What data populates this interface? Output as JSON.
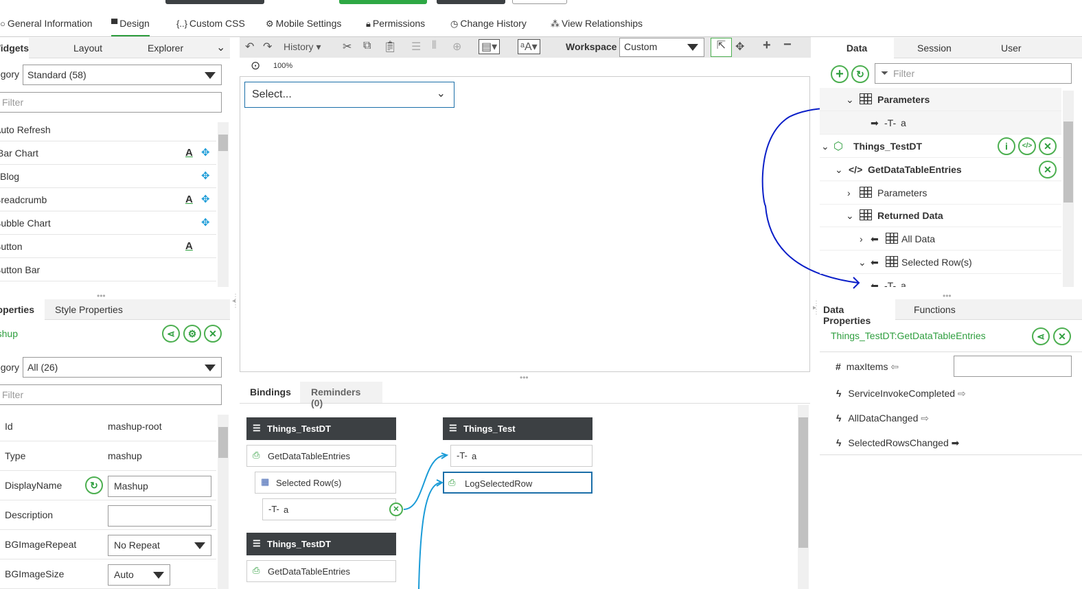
{
  "tabs": [
    {
      "label": "General Information",
      "icon": "info-icon"
    },
    {
      "label": "Design",
      "icon": "design-icon"
    },
    {
      "label": "Custom CSS",
      "icon": "braces-icon"
    },
    {
      "label": "Mobile Settings",
      "icon": "gear-icon"
    },
    {
      "label": "Permissions",
      "icon": "lock-icon"
    },
    {
      "label": "Change History",
      "icon": "clock-icon"
    },
    {
      "label": "View Relationships",
      "icon": "relationships-icon"
    }
  ],
  "widgets": {
    "tabs": [
      "Widgets",
      "Layout",
      "Explorer"
    ],
    "category_label": "Category",
    "category_value": "Standard (58)",
    "filter_placeholder": "Filter",
    "items": [
      "Auto Refresh",
      "Bar Chart",
      "Blog",
      "Breadcrumb",
      "Bubble Chart",
      "Button",
      "Button Bar"
    ]
  },
  "properties": {
    "tabs": [
      "Properties",
      "Style Properties"
    ],
    "title": "Mashup",
    "category_label": "Category",
    "category_value": "All (26)",
    "filter_placeholder": "Filter",
    "rows": [
      {
        "label": "Id",
        "value": "mashup-root"
      },
      {
        "label": "Type",
        "value": "mashup"
      },
      {
        "label": "DisplayName",
        "value": "Mashup"
      },
      {
        "label": "Description",
        "value": ""
      },
      {
        "label": "BGImageRepeat",
        "value": "No Repeat"
      },
      {
        "label": "BGImageSize",
        "value": "Auto"
      }
    ]
  },
  "toolbar": {
    "history": "History",
    "workspace_label": "Workspace",
    "workspace_value": "Custom",
    "zoom": "100%"
  },
  "canvas": {
    "select_placeholder": "Select..."
  },
  "bindings": {
    "tabs": [
      "Bindings",
      "Reminders (0)"
    ],
    "source1": {
      "title": "Things_TestDT",
      "service": "GetDataTableEntries",
      "sub": "Selected Row(s)",
      "field": "a"
    },
    "target": {
      "title": "Things_Test",
      "field": "a",
      "service": "LogSelectedRow"
    },
    "source2": {
      "title": "Things_TestDT",
      "service": "GetDataTableEntries"
    }
  },
  "data": {
    "tabs": [
      "Data",
      "Session",
      "User"
    ],
    "filter_placeholder": "Filter",
    "tree": [
      {
        "label": "Parameters"
      },
      {
        "label": "a"
      },
      {
        "label": "Things_TestDT"
      },
      {
        "label": "GetDataTableEntries"
      },
      {
        "label": "Parameters"
      },
      {
        "label": "Returned Data"
      },
      {
        "label": "All Data"
      },
      {
        "label": "Selected Row(s)"
      },
      {
        "label": "a"
      }
    ]
  },
  "data_properties": {
    "tabs": [
      "Data Properties",
      "Functions"
    ],
    "title": "Things_TestDT:GetDataTableEntries",
    "items": [
      {
        "label": "maxItems",
        "icon": "hash-icon"
      },
      {
        "label": "ServiceInvokeCompleted",
        "icon": "bolt-icon"
      },
      {
        "label": "AllDataChanged",
        "icon": "bolt-icon"
      },
      {
        "label": "SelectedRowsChanged",
        "icon": "bolt-icon"
      }
    ]
  },
  "colors": {
    "accent": "#2e9e3e",
    "binding_line": "#1a9bd7",
    "annotation": "#0a1ec8",
    "header_dark": "#3c4043"
  }
}
